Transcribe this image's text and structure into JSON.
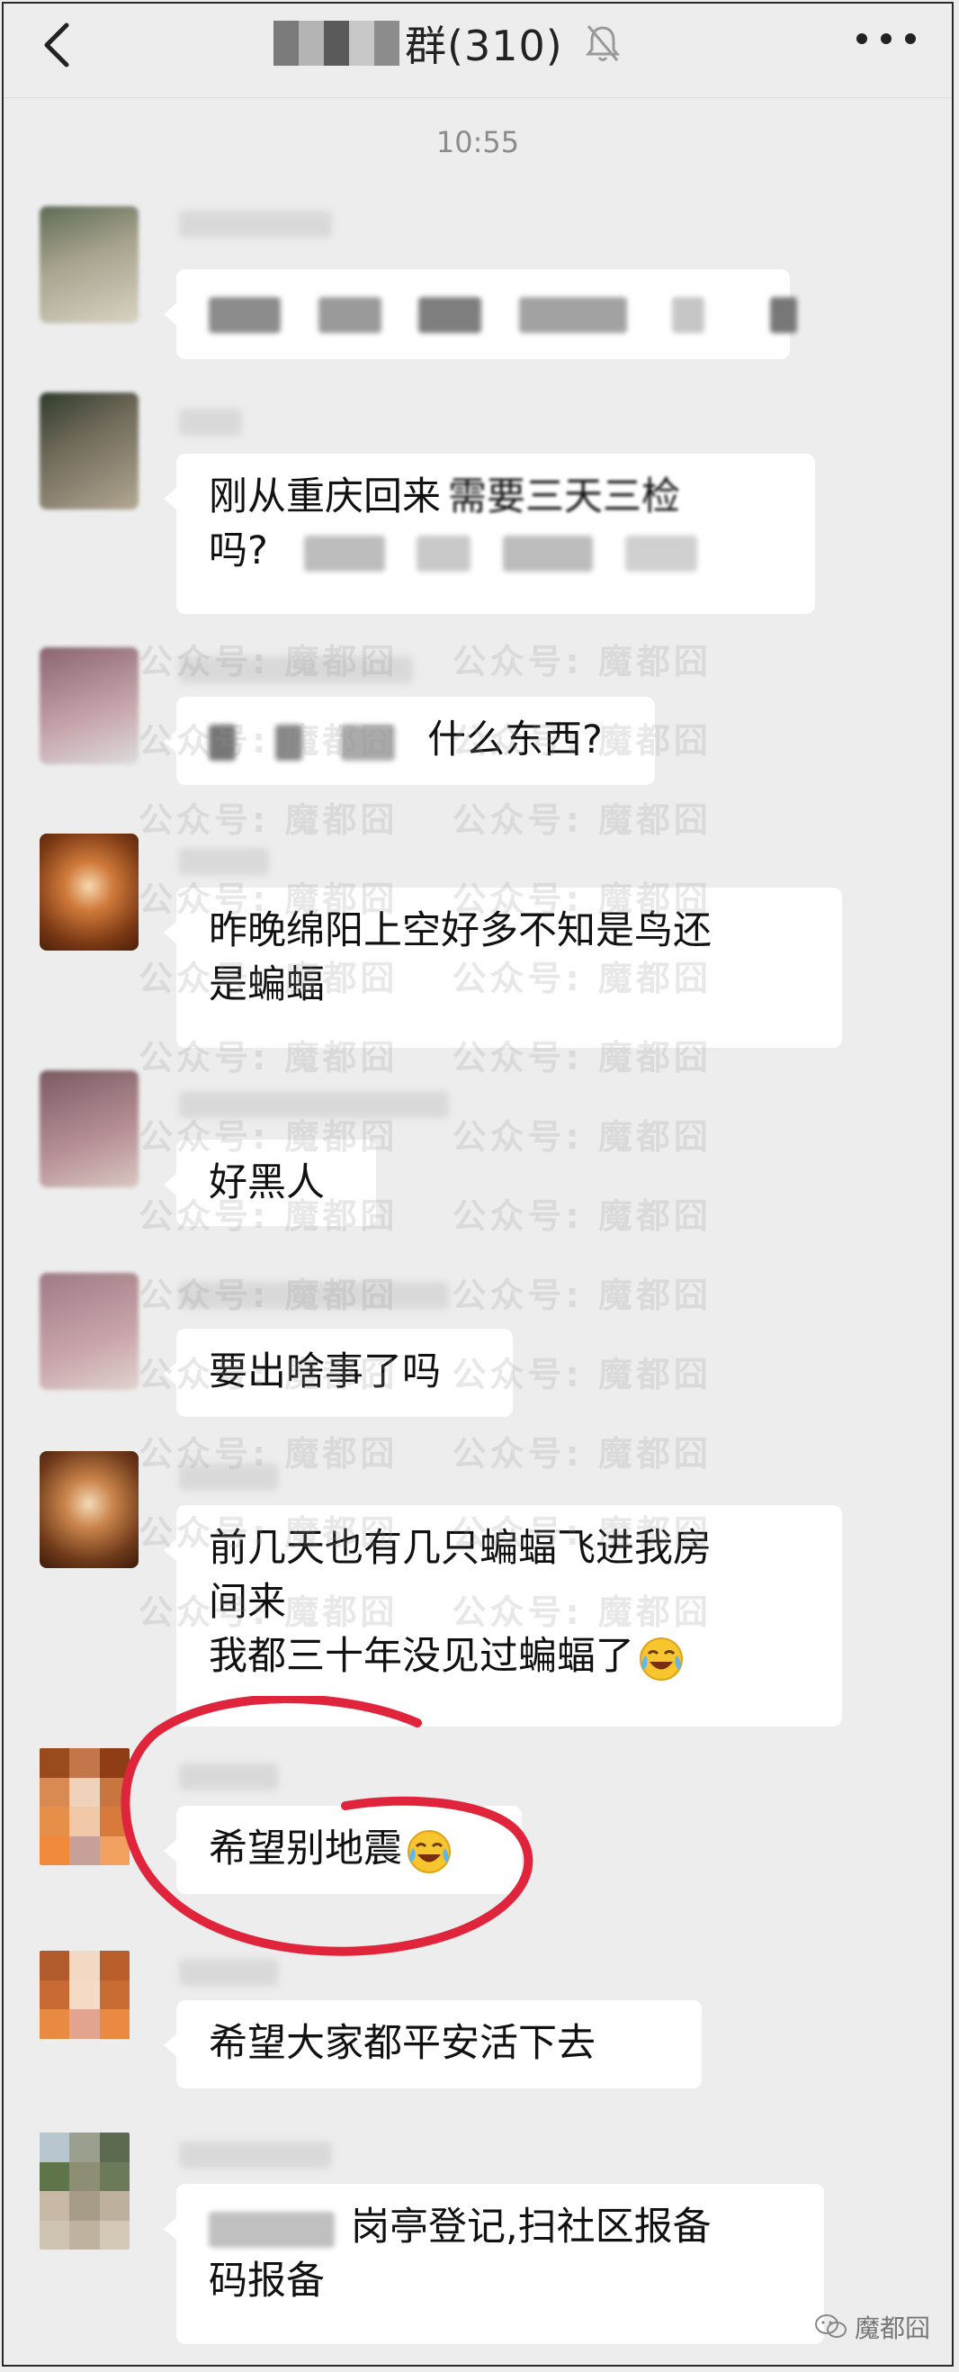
{
  "header": {
    "title_suffix": "群(310)",
    "back_icon": "chevron-left-icon",
    "mute_icon": "bell-off-icon",
    "more_icon": "more-dots-icon"
  },
  "timestamp": "10:55",
  "messages": [
    {
      "text": ""
    },
    {
      "text_line1": "刚从重庆回来",
      "text_line1b": "需要三天三检",
      "text_line2": "吗?"
    },
    {
      "text": "什么东西?"
    },
    {
      "text_line1": "昨晚绵阳上空好多不知是鸟还",
      "text_line2": "是蝙蝠"
    },
    {
      "text": "好黑人"
    },
    {
      "text": "要出啥事了吗"
    },
    {
      "text_line1": "前几天也有几只蝙蝠飞进我房",
      "text_line2": "间来",
      "text_line3": "我都三十年没见过蝙蝠了",
      "emoji": "crying-laughing-emoji"
    },
    {
      "text": "希望别地震",
      "emoji": "crying-laughing-emoji"
    },
    {
      "text": "希望大家都平安活下去"
    },
    {
      "text_line1": "岗亭登记,扫社区报备",
      "text_line2": "码报备"
    }
  ],
  "watermark": "公众号: 魔都囧",
  "corner_mark": "魔都囧",
  "colors": {
    "background": "#ededed",
    "bubble": "#ffffff",
    "annotation": "#e0243b"
  }
}
